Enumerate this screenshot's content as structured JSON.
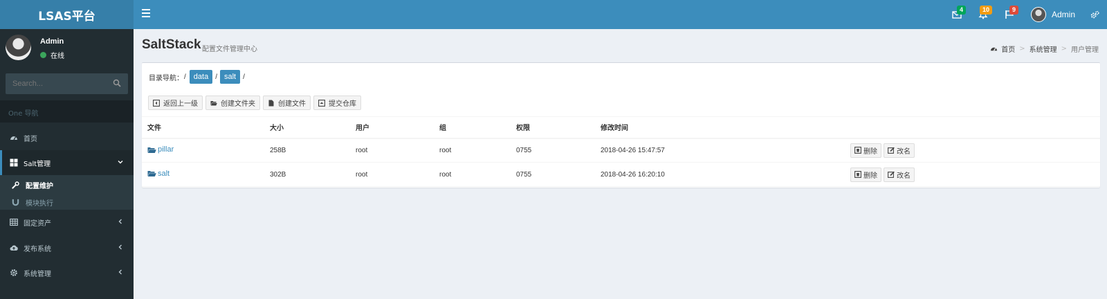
{
  "app": {
    "logo": "LSAS平台"
  },
  "topbar": {
    "mail_count": "4",
    "bell_count": "10",
    "flag_count": "9",
    "user_name": "Admin",
    "colors": {
      "mail_badge": "#00a65a",
      "bell_badge": "#f39c12",
      "flag_badge": "#dd4b39"
    }
  },
  "sidebar": {
    "user": {
      "name": "Admin",
      "status": "在线"
    },
    "search_placeholder": "Search...",
    "header": "One 导航",
    "items": [
      {
        "label": "首页",
        "icon": "dashboard-icon"
      },
      {
        "label": "Salt管理",
        "icon": "grid-icon",
        "expanded": true
      },
      {
        "label": "固定资产",
        "icon": "table-icon"
      },
      {
        "label": "发布系统",
        "icon": "cloud-upload-icon"
      },
      {
        "label": "系统管理",
        "icon": "gear-icon"
      }
    ],
    "sub_items": [
      {
        "label": "配置维护",
        "icon": "wrench-icon",
        "active": true
      },
      {
        "label": "模块执行",
        "icon": "magnet-icon"
      }
    ]
  },
  "page": {
    "title": "SaltStack",
    "subtitle": "配置文件管理中心",
    "breadcrumb": [
      "首页",
      "系统管理",
      "用户管理"
    ]
  },
  "box": {
    "dir_label": "目录导航：",
    "dir_path": [
      "data",
      "salt"
    ],
    "toolbar": [
      "返回上一级",
      "创建文件夹",
      "创建文件",
      "提交仓库"
    ],
    "columns": [
      "文件",
      "大小",
      "用户",
      "组",
      "权限",
      "修改时间"
    ],
    "rows": [
      {
        "name": "pillar",
        "size": "258B",
        "user": "root",
        "group": "root",
        "perm": "0755",
        "mtime": "2018-04-26 15:47:57"
      },
      {
        "name": "salt",
        "size": "302B",
        "user": "root",
        "group": "root",
        "perm": "0755",
        "mtime": "2018-04-26 16:20:10"
      }
    ],
    "row_actions": {
      "delete": "删除",
      "rename": "改名"
    }
  }
}
